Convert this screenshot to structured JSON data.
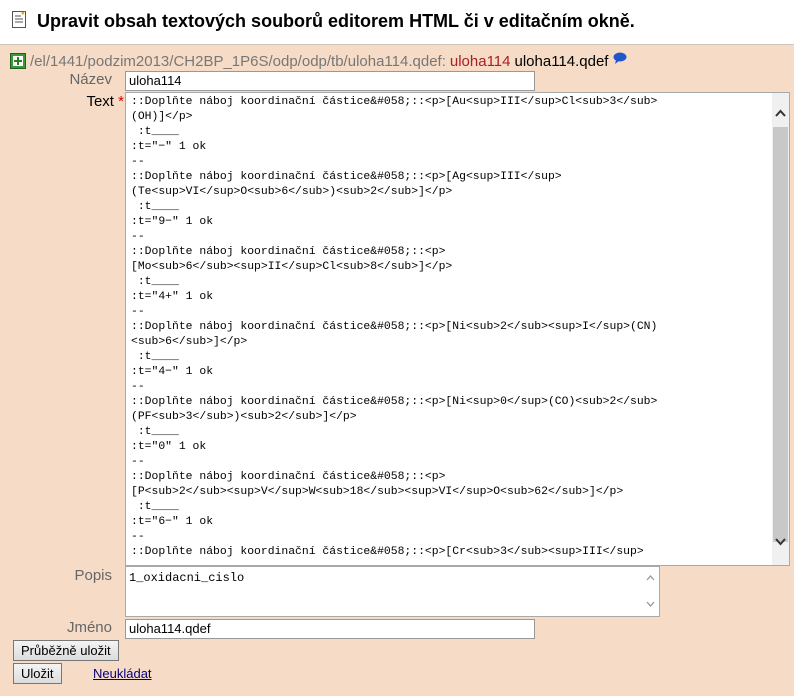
{
  "page": {
    "title": "Upravit obsah textových souborů editorem HTML či v editačním okně."
  },
  "path": {
    "text": "/el/1441/podzim2013/CH2BP_1P6S/odp/odp/tb/uloha114.qdef:",
    "name": "uloha114",
    "file": "uloha114.qdef"
  },
  "form": {
    "nazev_label": "Název",
    "nazev_value": "uloha114",
    "text_label": "Text",
    "text_required_marker": "*",
    "text_value": "::Doplňte náboj koordinační částice&#058;::<p>[Au<sup>III</sup>Cl<sub>3</sub>\n(OH)]</p>\n :t____\n:t=\"−\" 1 ok\n--\n::Doplňte náboj koordinační částice&#058;::<p>[Ag<sup>III</sup>\n(Te<sup>VI</sup>O<sub>6</sub>)<sub>2</sub>]</p>\n :t____\n:t=\"9−\" 1 ok\n--\n::Doplňte náboj koordinační částice&#058;::<p>\n[Mo<sub>6</sub><sup>II</sup>Cl<sub>8</sub>]</p>\n :t____\n:t=\"4+\" 1 ok\n--\n::Doplňte náboj koordinační částice&#058;::<p>[Ni<sub>2</sub><sup>I</sup>(CN)\n<sub>6</sub>]</p>\n :t____\n:t=\"4−\" 1 ok\n--\n::Doplňte náboj koordinační částice&#058;::<p>[Ni<sup>0</sup>(CO)<sub>2</sub>\n(PF<sub>3</sub>)<sub>2</sub>]</p>\n :t____\n:t=\"0\" 1 ok\n--\n::Doplňte náboj koordinační částice&#058;::<p>\n[P<sub>2</sub><sup>V</sup>W<sub>18</sub><sup>VI</sup>O<sub>62</sub>]</p>\n :t____\n:t=\"6−\" 1 ok\n--\n::Doplňte náboj koordinační částice&#058;::<p>[Cr<sub>3</sub><sup>III</sup>",
    "popis_label": "Popis",
    "popis_value": "1_oxidacni_cislo",
    "jmeno_label": "Jméno",
    "jmeno_value": "uloha114.qdef"
  },
  "buttons": {
    "save_progress": "Průběžně uložit",
    "save": "Uložit",
    "discard": "Neukládat"
  }
}
